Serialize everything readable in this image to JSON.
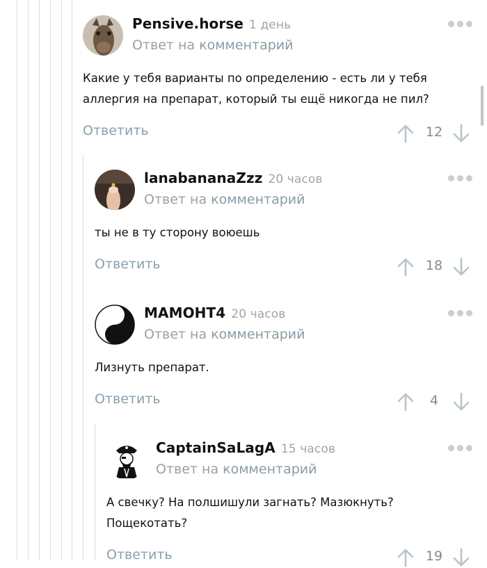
{
  "comments": [
    {
      "username": "Pensive.horse",
      "time": "1 день",
      "reply_prefix": "Ответ на ",
      "reply_link": "комментарий",
      "text": "Какие у тебя варианты по определению - есть ли у тебя аллергия на препарат, который ты ещё никогда не пил?",
      "reply_label": "Ответить",
      "rating": "12"
    },
    {
      "username": "lanabananaZzz",
      "time": "20 часов",
      "reply_prefix": "Ответ на ",
      "reply_link": "комментарий",
      "text": "ты не в ту сторону воюешь",
      "reply_label": "Ответить",
      "rating": "18"
    },
    {
      "username": "МАМОНТ4",
      "time": "20 часов",
      "reply_prefix": "Ответ на ",
      "reply_link": "комментарий",
      "text": "Лизнуть препарат.",
      "reply_label": "Ответить",
      "rating": "4"
    },
    {
      "username": "CaptainSaLagA",
      "time": "15 часов",
      "reply_prefix": "Ответ на ",
      "reply_link": "комментарий",
      "text": "А свечку? На полшишули загнать? Мазюкнуть? Пощекотать?",
      "reply_label": "Ответить",
      "rating": "19"
    }
  ],
  "icons": {
    "avatar_1": "horse-avatar",
    "avatar_2": "finger-avatar",
    "avatar_3": "yin-yang-avatar",
    "avatar_4": "pirate-avatar",
    "more": "more-dots-icon",
    "upvote": "arrow-up-icon",
    "downvote": "arrow-down-icon"
  },
  "colors": {
    "link": "#8aa0ab",
    "muted": "#a0a5a8",
    "thread_line": "#dcdcdc"
  }
}
